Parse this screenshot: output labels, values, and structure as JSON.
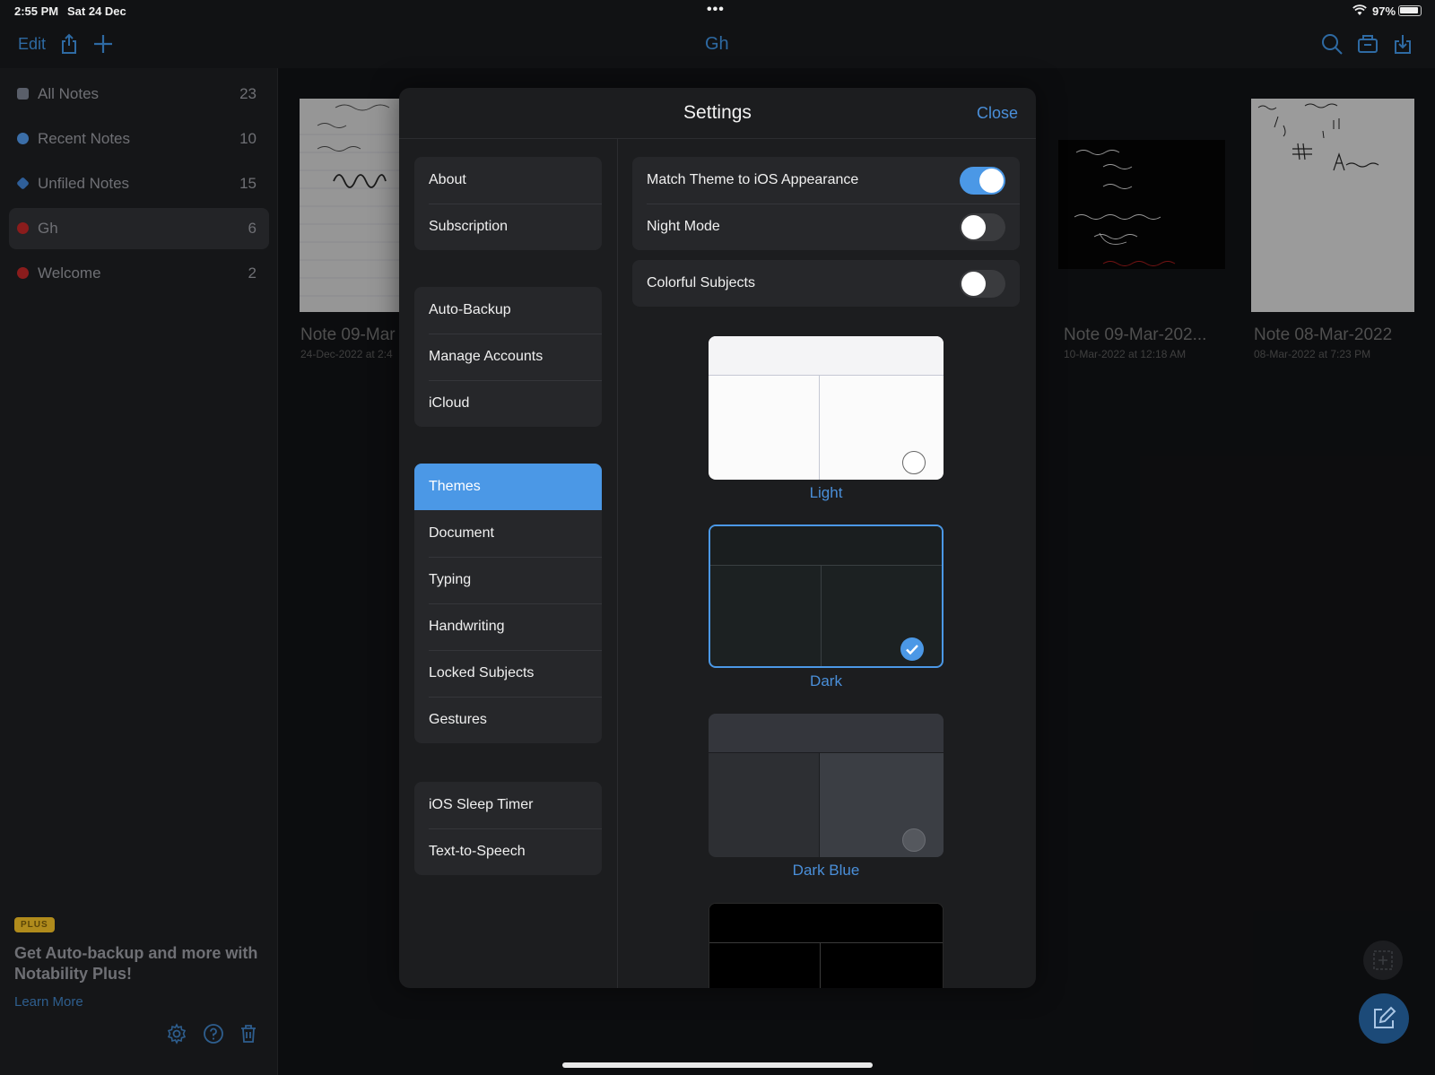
{
  "status_bar": {
    "time": "2:55 PM",
    "date": "Sat 24 Dec",
    "dots": "•••",
    "battery": "97%"
  },
  "nav": {
    "edit": "Edit",
    "title": "Gh"
  },
  "sidebar": {
    "items": [
      {
        "label": "All Notes",
        "count": "23",
        "dot_color": "#5a5f6a"
      },
      {
        "label": "Recent Notes",
        "count": "10",
        "dot_color": "#3b6ea8"
      },
      {
        "label": "Unfiled Notes",
        "count": "15",
        "dot_color": "#2f5f99"
      },
      {
        "label": "Gh",
        "count": "6",
        "dot_color": "#8a1c1c"
      },
      {
        "label": "Welcome",
        "count": "2",
        "dot_color": "#8a1c1c"
      }
    ],
    "plus_badge": "PLUS",
    "promo": "Get Auto-backup and more with Notability Plus!",
    "learn_more": "Learn More"
  },
  "notes": [
    {
      "title": "Note 09-Mar",
      "date": "24-Dec-2022 at 2:4"
    },
    {
      "title": "Note 09-Mar-202...",
      "date": "10-Mar-2022 at 12:18 AM"
    },
    {
      "title": "Note 08-Mar-2022",
      "date": "08-Mar-2022 at 7:23 PM"
    }
  ],
  "settings": {
    "title": "Settings",
    "close": "Close",
    "menu_groups": [
      [
        "About",
        "Subscription"
      ],
      [
        "Auto-Backup",
        "Manage Accounts",
        "iCloud"
      ],
      [
        "Themes",
        "Document",
        "Typing",
        "Handwriting",
        "Locked Subjects",
        "Gestures"
      ],
      [
        "iOS Sleep Timer",
        "Text-to-Speech"
      ]
    ],
    "selected_menu": "Themes",
    "toggles": {
      "match_theme": {
        "label": "Match Theme to iOS Appearance",
        "on": true
      },
      "night_mode": {
        "label": "Night Mode",
        "on": false
      },
      "colorful_subjects": {
        "label": "Colorful Subjects",
        "on": false
      }
    },
    "themes": [
      {
        "label": "Light",
        "selected": false
      },
      {
        "label": "Dark",
        "selected": true
      },
      {
        "label": "Dark Blue",
        "selected": false
      },
      {
        "label": "",
        "selected": false
      }
    ]
  },
  "colors": {
    "accent": "#4b98e6",
    "nav_accent": "#2e6aa3",
    "background": "#111214"
  }
}
